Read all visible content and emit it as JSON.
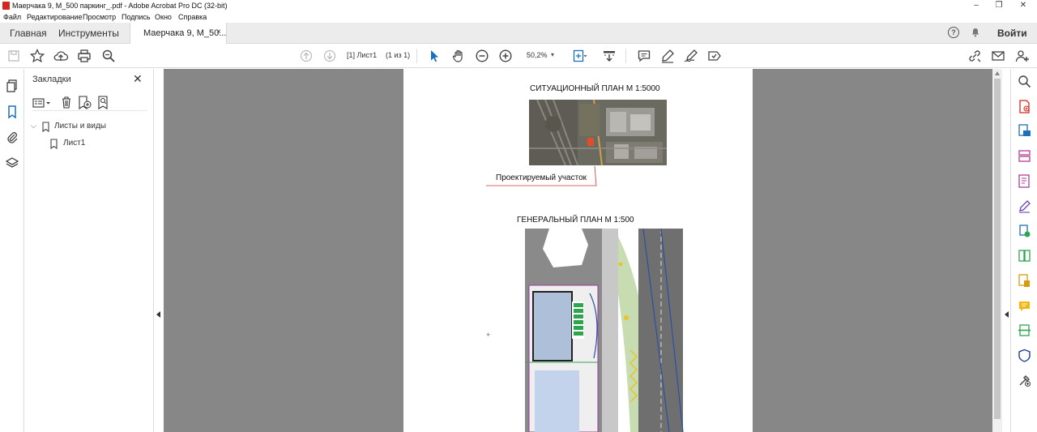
{
  "window": {
    "title": "Маерчака 9, М_500 паркинг_.pdf - Adobe Acrobat Pro DC (32-bit)",
    "controls": {
      "minimize": "–",
      "restore": "❐",
      "close": "✕"
    }
  },
  "menubar": {
    "items": [
      "Файл",
      "Редактирование",
      "Просмотр",
      "Подпись",
      "Окно",
      "Справка"
    ]
  },
  "tabs": {
    "home": "Главная",
    "tools": "Инструменты",
    "document": "Маерчака 9, М_50...",
    "close": "×",
    "help": "?",
    "signin": "Войти"
  },
  "toolbar": {
    "page_field": "[1] Лист1",
    "page_of": "(1 из 1)",
    "zoom": "50,2%",
    "zoom_caret": "▾"
  },
  "bookmarks": {
    "title": "Закладки",
    "close": "✕",
    "items": [
      {
        "label": "Листы и виды",
        "expanded": true
      },
      {
        "label": "Лист1"
      }
    ]
  },
  "document": {
    "situation_title": "СИТУАЦИОННЫЙ ПЛАН М 1:5000",
    "site_label": "Проектируемый участок",
    "general_title": "ГЕНЕРАЛЬНЫЙ ПЛАН М 1:500"
  },
  "colors": {
    "accent": "#d6261f",
    "canvas_bg": "#878787",
    "tabbar_bg": "#ececec",
    "selected_tool": "#1d6fb8"
  }
}
